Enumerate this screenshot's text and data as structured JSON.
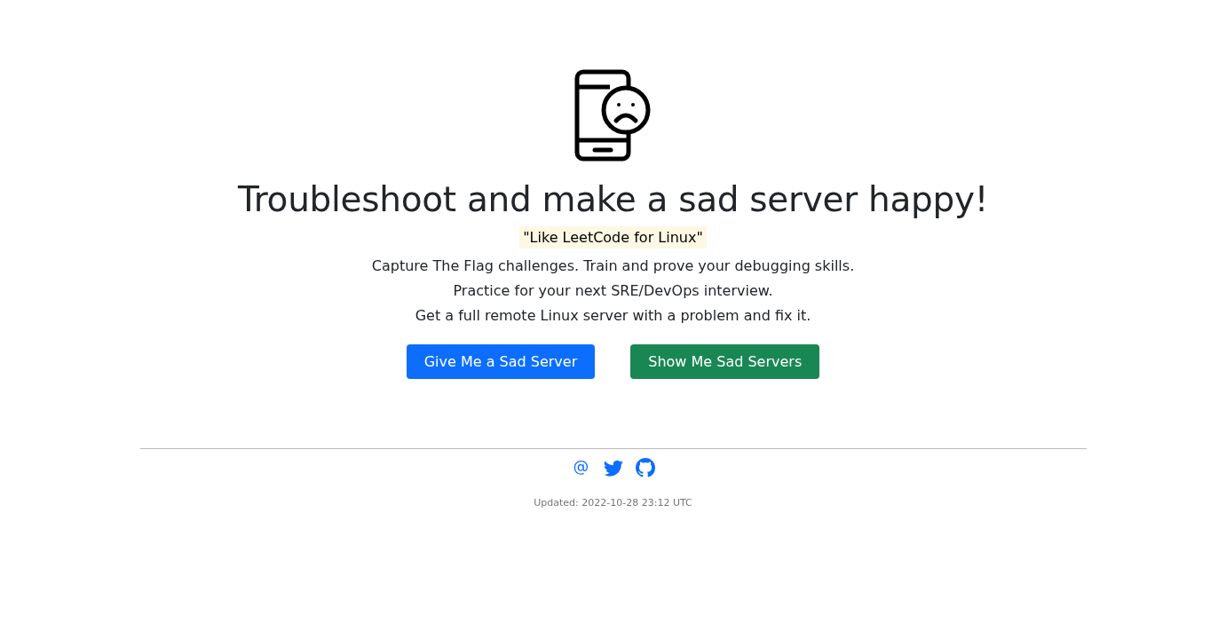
{
  "title": "Troubleshoot and make a sad server happy!",
  "quote": "\"Like LeetCode for Linux\"",
  "lines": [
    "Capture The Flag challenges. Train and prove your debugging skills.",
    "Practice for your next SRE/DevOps interview.",
    "Get a full remote Linux server with a problem and fix it."
  ],
  "buttons": [
    {
      "label": "Give Me a Sad Server",
      "kind": "primary"
    },
    {
      "label": "Show Me Sad Servers",
      "kind": "success"
    }
  ],
  "footer": {
    "links": [
      {
        "kind": "email"
      },
      {
        "kind": "twitter"
      },
      {
        "kind": "github"
      }
    ],
    "updated": "Updated: 2022-10-28 23:12 UTC"
  }
}
